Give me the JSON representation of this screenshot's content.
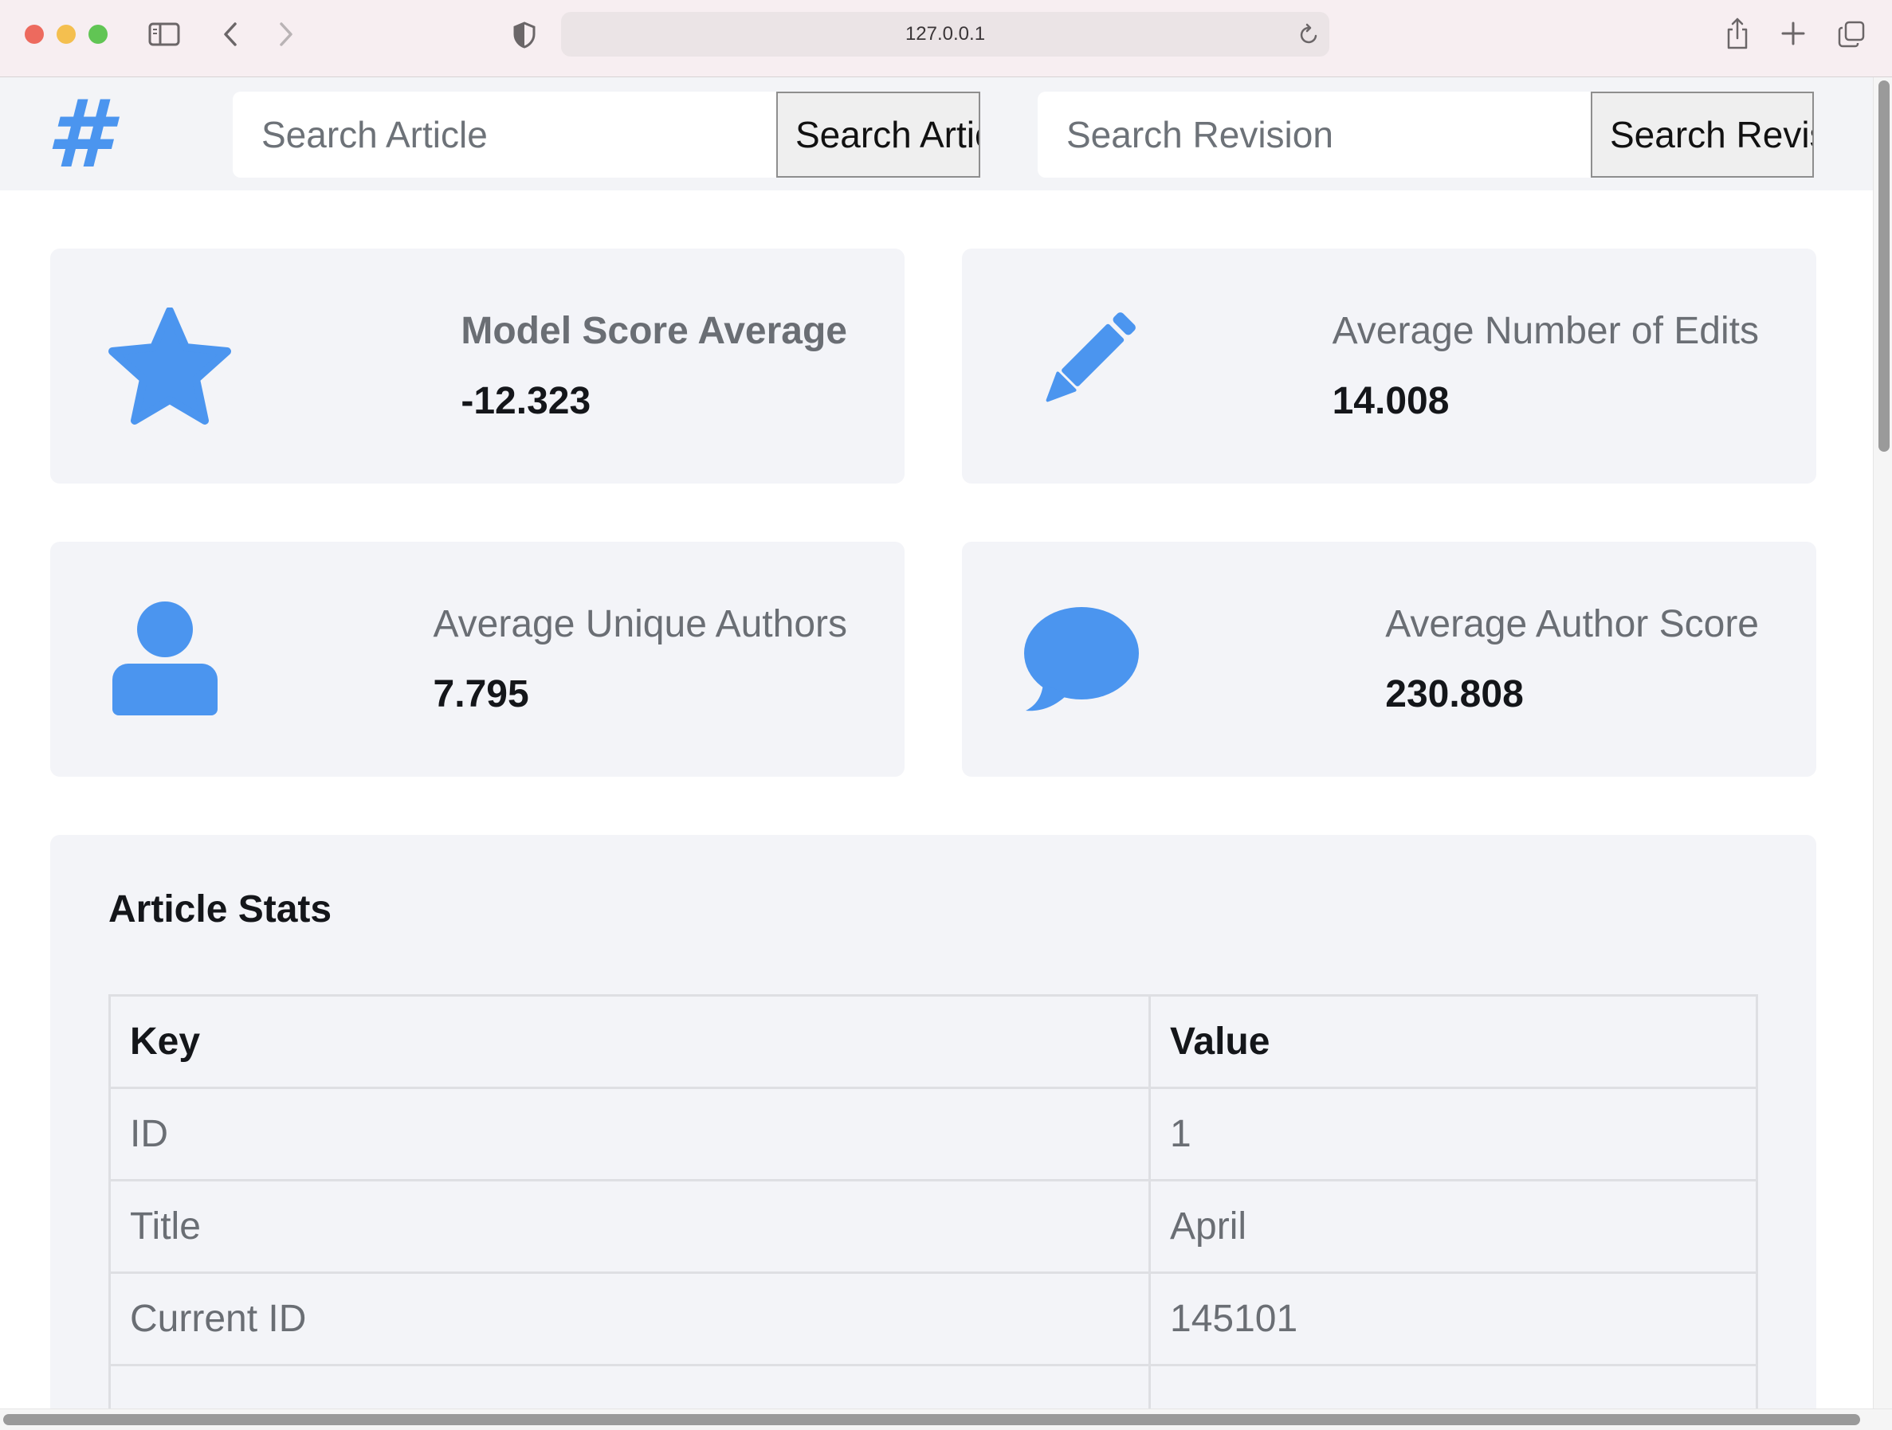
{
  "browser": {
    "url": "127.0.0.1",
    "icons": [
      "sidebar-toggle-icon",
      "back-arrow-icon",
      "forward-arrow-icon",
      "shield-icon",
      "reload-icon",
      "share-icon",
      "new-tab-plus-icon",
      "tab-overview-icon"
    ]
  },
  "header": {
    "logo": "#",
    "search_article": {
      "placeholder": "Search Article",
      "button_label": "Search Article"
    },
    "search_revision": {
      "placeholder": "Search Revision",
      "button_label": "Search Revision"
    }
  },
  "cards": [
    {
      "icon": "star-icon",
      "label": "Model Score Average",
      "value": "-12.323"
    },
    {
      "icon": "pencil-icon",
      "label": "Average Number of Edits",
      "value": "14.008"
    },
    {
      "icon": "user-icon",
      "label": "Average Unique Authors",
      "value": "7.795"
    },
    {
      "icon": "comment-icon",
      "label": "Average Author Score",
      "value": "230.808"
    }
  ],
  "colors": {
    "accent": "#4b95ef",
    "card_bg": "#f3f4f8",
    "header_bg": "#f3f4f7"
  },
  "article_stats": {
    "title": "Article Stats",
    "columns": [
      "Key",
      "Value"
    ],
    "rows": [
      {
        "key": "ID",
        "value": "1"
      },
      {
        "key": "Title",
        "value": "April"
      },
      {
        "key": "Current ID",
        "value": "145101"
      },
      {
        "key": "",
        "value": ""
      }
    ]
  }
}
